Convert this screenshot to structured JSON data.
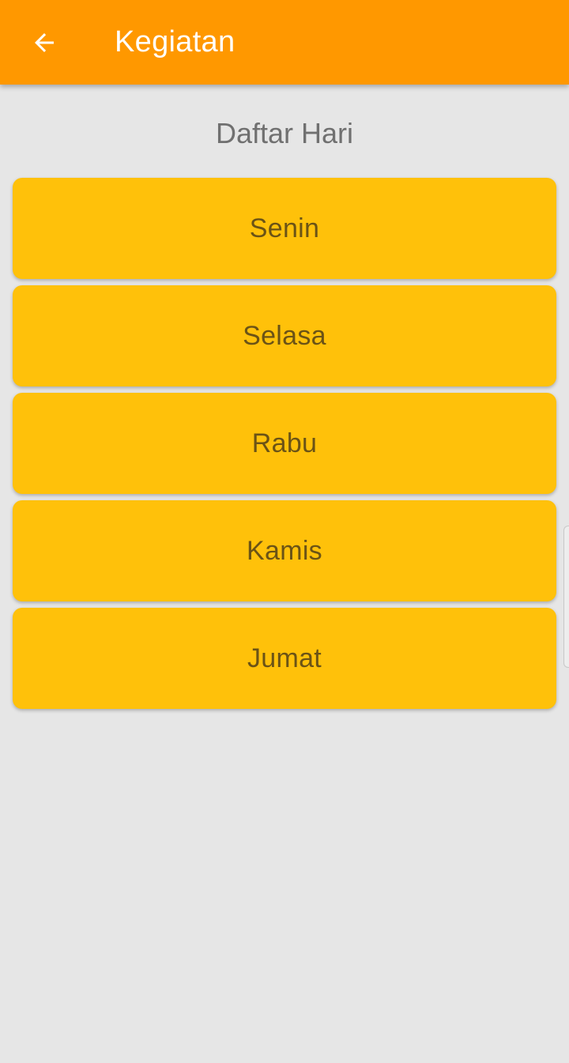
{
  "app_bar": {
    "title": "Kegiatan",
    "back_icon": "arrow-left-icon",
    "color": "#ff9800"
  },
  "main": {
    "heading": "Daftar Hari",
    "days": [
      {
        "label": "Senin"
      },
      {
        "label": "Selasa"
      },
      {
        "label": "Rabu"
      },
      {
        "label": "Kamis"
      },
      {
        "label": "Jumat"
      }
    ],
    "button_color": "#ffc10a",
    "text_color": "#6b5316",
    "background": "#e6e6e6"
  }
}
